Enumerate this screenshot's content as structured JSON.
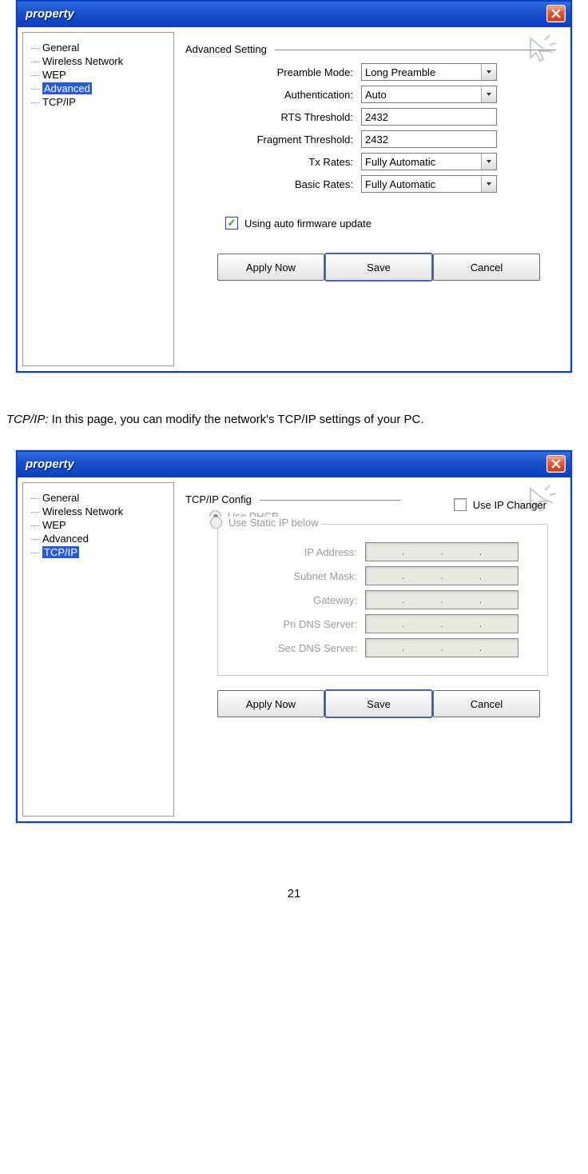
{
  "window_title": "property",
  "tree_items": [
    "General",
    "Wireless Network",
    "WEP",
    "Advanced",
    "TCP/IP"
  ],
  "dialog1": {
    "selected_tree_index": 3,
    "section_title": "Advanced Setting",
    "rows": [
      {
        "label": "Preamble Mode:",
        "type": "combo",
        "value": "Long Preamble"
      },
      {
        "label": "Authentication:",
        "type": "combo",
        "value": "Auto"
      },
      {
        "label": "RTS Threshold:",
        "type": "text",
        "value": "2432"
      },
      {
        "label": "Fragment Threshold:",
        "type": "text",
        "value": "2432"
      },
      {
        "label": "Tx Rates:",
        "type": "combo",
        "value": "Fully Automatic"
      },
      {
        "label": "Basic Rates:",
        "type": "combo",
        "value": "Fully Automatic"
      }
    ],
    "firmware_checkbox": {
      "checked": true,
      "label": "Using auto firmware update"
    }
  },
  "caption": {
    "lead": "TCP/IP:",
    "text": " In this page, you can modify the network's TCP/IP settings of your PC."
  },
  "dialog2": {
    "selected_tree_index": 4,
    "section_title": "TCP/IP Config",
    "use_ip_changer": {
      "checked": false,
      "label": "Use IP Changer"
    },
    "radio_dhcp": {
      "selected": true,
      "label": "Use DHCP"
    },
    "radio_static": {
      "selected": false,
      "label": "Use Static IP below"
    },
    "ip_rows": [
      {
        "label": "IP Address:"
      },
      {
        "label": "Subnet Mask:"
      },
      {
        "label": "Gateway:"
      },
      {
        "label": "Pri DNS Server:"
      },
      {
        "label": "Sec DNS Server:"
      }
    ]
  },
  "buttons": {
    "apply": "Apply Now",
    "save": "Save",
    "cancel": "Cancel"
  },
  "page_number": "21"
}
